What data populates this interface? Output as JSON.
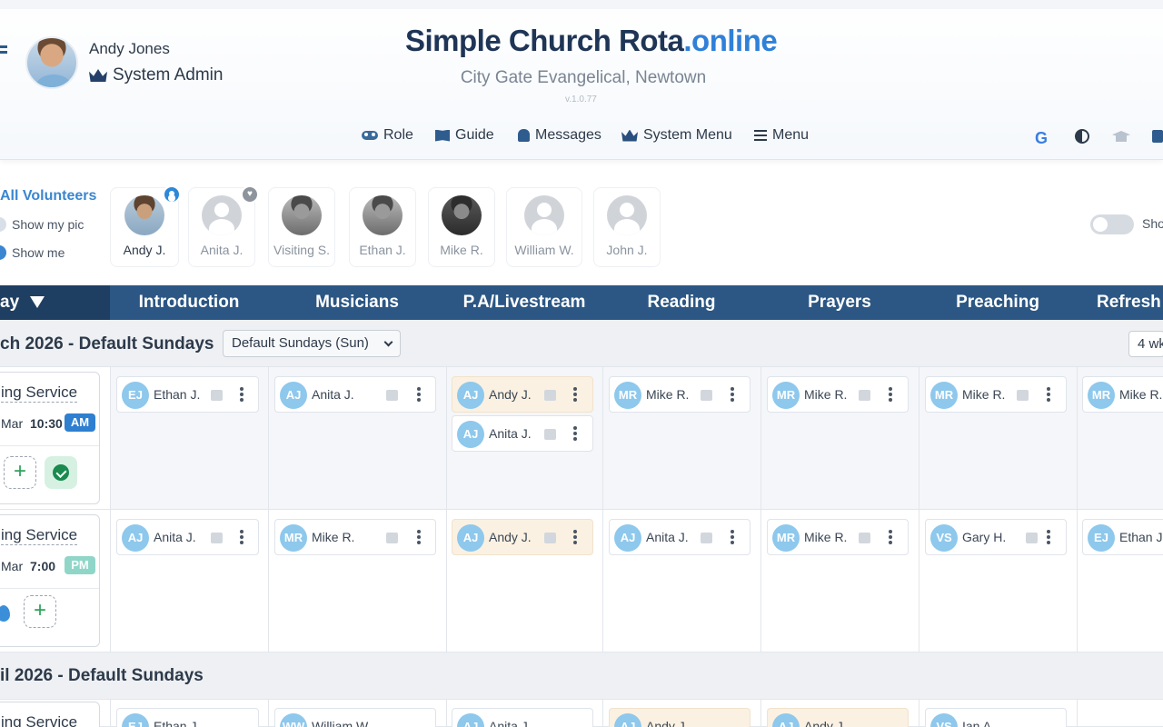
{
  "header": {
    "user_name": "Andy Jones",
    "user_role": "System Admin",
    "brand_main": "Simple Church Rota",
    "brand_accent": ".online",
    "church": "City Gate Evangelical, Newtown",
    "version": "v.1.0.77",
    "nav": [
      {
        "label": "Role",
        "icon": "role-icon"
      },
      {
        "label": "Guide",
        "icon": "book-icon"
      },
      {
        "label": "Messages",
        "icon": "bell-icon"
      },
      {
        "label": "System Menu",
        "icon": "crown-icon"
      },
      {
        "label": "Menu",
        "icon": "menu-icon"
      }
    ],
    "tools": {
      "google": "G"
    }
  },
  "volunteers": {
    "all_label": "All Volunteers",
    "show_pic_label": "Show my pic",
    "show_me_label": "Show me",
    "toggle_label": "Show",
    "people": [
      "Andy J.",
      "Anita J.",
      "Visiting S.",
      "Ethan J.",
      "Mike R.",
      "William W.",
      "John J."
    ]
  },
  "roles_header": {
    "day_label": "ay",
    "roles": [
      "Introduction",
      "Musicians",
      "P.A/Livestream",
      "Reading",
      "Prayers",
      "Preaching",
      "Refresh"
    ]
  },
  "periods": [
    {
      "title": "ch 2026 - Default Sundays",
      "select": "Default Sundays (Sun)",
      "weeks": "4 wk"
    },
    {
      "title": "il 2026 - Default Sundays"
    }
  ],
  "services": [
    {
      "name": "ing Service",
      "date": "Mar",
      "time": "10:30",
      "ampm": "AM",
      "assignments": [
        [
          {
            "initials": "EJ",
            "name": "Ethan J."
          }
        ],
        [
          {
            "initials": "AJ",
            "name": "Anita J."
          }
        ],
        [
          {
            "initials": "AJ",
            "name": "Andy J."
          },
          {
            "initials": "AJ",
            "name": "Anita J."
          }
        ],
        [
          {
            "initials": "MR",
            "name": "Mike R."
          }
        ],
        [
          {
            "initials": "MR",
            "name": "Mike R."
          }
        ],
        [
          {
            "initials": "MR",
            "name": "Mike R."
          }
        ],
        [
          {
            "initials": "MR",
            "name": "Mike R."
          }
        ]
      ]
    },
    {
      "name": "ing Service",
      "date": "Mar",
      "time": "7:00",
      "ampm": "PM",
      "assignments": [
        [
          {
            "initials": "AJ",
            "name": "Anita J."
          }
        ],
        [
          {
            "initials": "MR",
            "name": "Mike R."
          }
        ],
        [
          {
            "initials": "AJ",
            "name": "Andy J."
          }
        ],
        [
          {
            "initials": "AJ",
            "name": "Anita J."
          }
        ],
        [
          {
            "initials": "MR",
            "name": "Mike R."
          }
        ],
        [
          {
            "initials": "VS",
            "name": "Gary H."
          }
        ],
        [
          {
            "initials": "EJ",
            "name": "Ethan J."
          }
        ]
      ]
    },
    {
      "name": "ing Service",
      "assignments": [
        [
          {
            "initials": "EJ",
            "name": "Ethan J."
          }
        ],
        [
          {
            "initials": "WW",
            "name": "William W."
          }
        ],
        [
          {
            "initials": "AJ",
            "name": "Anita J."
          }
        ],
        [
          {
            "initials": "AJ",
            "name": "Andy J."
          }
        ],
        [
          {
            "initials": "AJ",
            "name": "Andy J."
          }
        ],
        [
          {
            "initials": "VS",
            "name": "Ian A."
          }
        ]
      ]
    }
  ],
  "colors": {
    "primary": "#2c5784",
    "accent": "#2f80d8",
    "am": "#2e7fd0",
    "pm": "#8fd6c8",
    "mine": "#fbf1e2"
  }
}
